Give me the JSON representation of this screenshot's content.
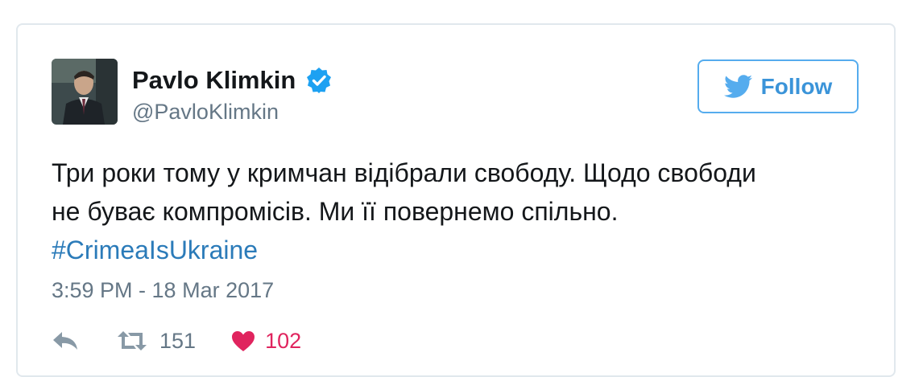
{
  "colors": {
    "accent": "#55acee",
    "link": "#2b7bb9",
    "muted": "#657786",
    "like": "#e0245e",
    "border": "#e1e8ed"
  },
  "author": {
    "name": "Pavlo Klimkin",
    "handle": "@PavloKlimkin",
    "verified": true
  },
  "follow_button": {
    "label": "Follow",
    "icon": "twitter-bird-icon"
  },
  "tweet": {
    "line1": "Три роки тому у кримчан відібрали свободу. Щодо свободи",
    "line2": "не буває компромісів. Ми її повернемо спільно.",
    "hashtag": "#CrimeaIsUkraine",
    "timestamp": "3:59 PM - 18 Mar 2017"
  },
  "actions": {
    "reply_icon": "reply-icon",
    "retweet_icon": "retweet-icon",
    "retweet_count": "151",
    "like_icon": "heart-icon",
    "like_count": "102"
  }
}
